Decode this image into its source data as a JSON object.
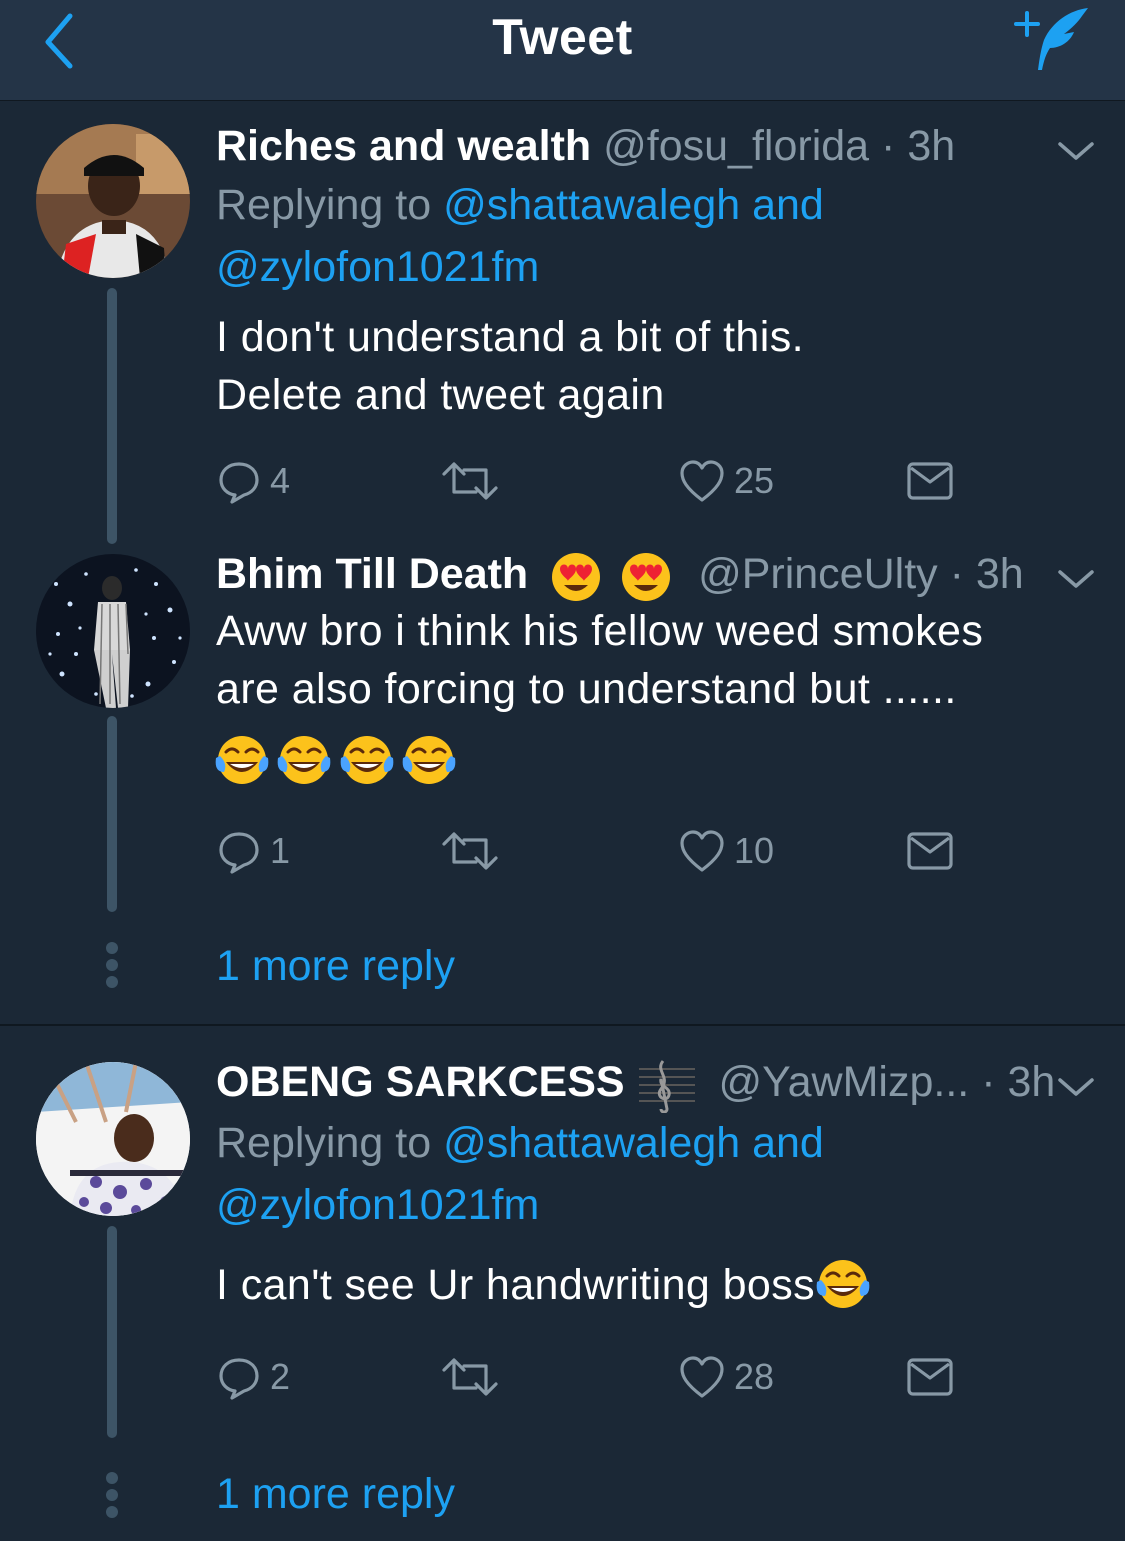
{
  "header": {
    "title": "Tweet"
  },
  "tweets": [
    {
      "display_name": "Riches and wealth",
      "handle": "@fosu_florida",
      "time": "· 3h",
      "replying_label": "Replying to",
      "reply_targets_line1": "@shattawalegh and",
      "reply_targets_line2": "@zylofon1021fm",
      "text_line1": "I don't understand a bit of this.",
      "text_line2": "Delete and tweet again",
      "replies": "4",
      "likes": "25"
    },
    {
      "display_name": "Bhim Till Death",
      "handle": "@PrinceUlty",
      "time": "· 3h",
      "text_line1": "Aww bro i think his fellow weed smokes",
      "text_line2": "are also forcing to understand but ......",
      "replies": "1",
      "likes": "10",
      "more_reply": "1 more reply"
    },
    {
      "display_name": "OBENG SARKCESS",
      "handle": "@YawMizp...",
      "time": "· 3h",
      "replying_label": "Replying to",
      "reply_targets_line1": "@shattawalegh and",
      "reply_targets_line2": "@zylofon1021fm",
      "text_line1": "I can't see Ur handwriting boss",
      "replies": "2",
      "likes": "28",
      "more_reply": "1 more reply"
    }
  ],
  "icons": {
    "back": "chevron-left-icon",
    "compose": "compose-quill-icon",
    "reply": "reply-bubble-icon",
    "retweet": "retweet-icon",
    "like": "heart-icon",
    "dm": "envelope-icon",
    "menu": "chevron-down-icon",
    "heart_eyes": "heart-eyes-emoji",
    "laughing": "tears-of-joy-emoji",
    "music": "musical-score-emoji"
  },
  "colors": {
    "background": "#1b2836",
    "header": "#243447",
    "accent": "#1da1f2",
    "muted": "#8899a6"
  }
}
